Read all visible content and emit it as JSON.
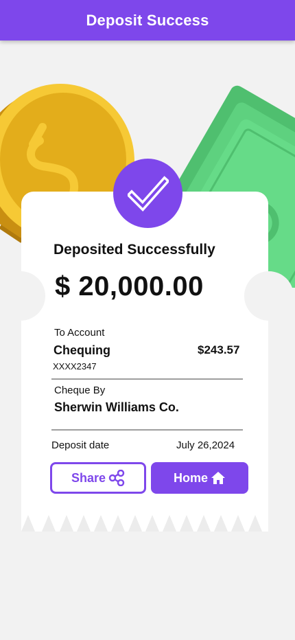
{
  "header": {
    "title": "Deposit Success"
  },
  "receipt": {
    "heading": "Deposited Successfully",
    "amount": "$ 20,000.00",
    "to_account": {
      "label": "To Account",
      "name": "Chequing",
      "balance": "$243.57",
      "number": "XXXX2347"
    },
    "cheque_by": {
      "label": "Cheque By",
      "name": "Sherwin Williams Co."
    },
    "deposit_date": {
      "label": "Deposit date",
      "value": "July 26,2024"
    }
  },
  "actions": {
    "share_label": "Share",
    "home_label": "Home"
  },
  "icons": {
    "check": "check-icon",
    "share": "share-icon",
    "home": "home-icon",
    "coin": "dollar-coin-illustration",
    "cash": "banknotes-illustration"
  },
  "colors": {
    "primary": "#7e47eb",
    "background": "#f2f2f2",
    "coin": "#f1c232",
    "cash": "#5ed17f"
  }
}
